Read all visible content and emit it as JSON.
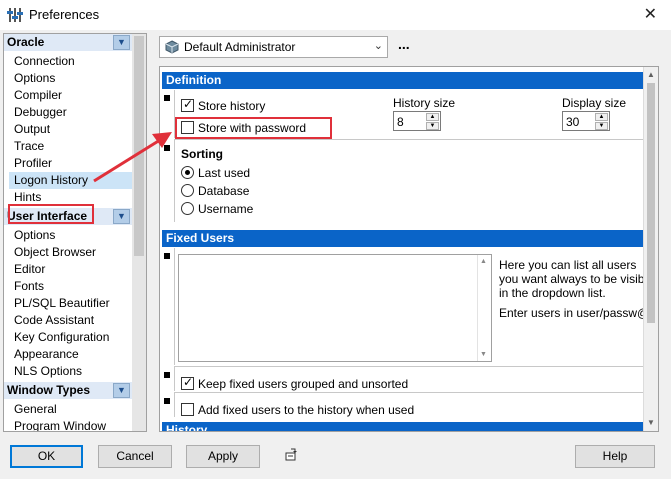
{
  "window": {
    "title": "Preferences",
    "close_glyph": "✕"
  },
  "sidebar": {
    "groups": [
      {
        "label": "Oracle",
        "items": [
          "Connection",
          "Options",
          "Compiler",
          "Debugger",
          "Output",
          "Trace",
          "Profiler",
          "Logon History",
          "Hints"
        ]
      },
      {
        "label": "User Interface",
        "items": [
          "Options",
          "Object Browser",
          "Editor",
          "Fonts",
          "PL/SQL Beautifier",
          "Code Assistant",
          "Key Configuration",
          "Appearance",
          "NLS Options"
        ]
      },
      {
        "label": "Window Types",
        "items": [
          "General",
          "Program Window"
        ]
      }
    ],
    "selected": "Logon History"
  },
  "profile": {
    "value": "Default Administrator",
    "more": "..."
  },
  "definition": {
    "header": "Definition",
    "store_history_label": "Store history",
    "store_history_checked": true,
    "store_password_label": "Store with password",
    "store_password_checked": false,
    "history_size_label": "History size",
    "history_size_value": "8",
    "display_size_label": "Display size",
    "display_size_value": "30",
    "sorting_label": "Sorting",
    "sorting_options": [
      "Last used",
      "Database",
      "Username"
    ],
    "sorting_selected": "Last used"
  },
  "fixed_users": {
    "header": "Fixed Users",
    "help_line1": "Here you can list all users",
    "help_line2": "you want always to be visib",
    "help_line3": "in the dropdown list.",
    "help_line4": "Enter users in user/passw@",
    "keep_grouped_label": "Keep fixed users grouped and unsorted",
    "keep_grouped_checked": true,
    "add_history_label": "Add fixed users to the history when used",
    "add_history_checked": false
  },
  "next_section_header": "History",
  "buttons": {
    "ok": "OK",
    "cancel": "Cancel",
    "apply": "Apply",
    "help": "Help"
  },
  "colors": {
    "section_header": "#0a64c8",
    "highlight": "#e0303a",
    "selection": "#cce4f7"
  }
}
